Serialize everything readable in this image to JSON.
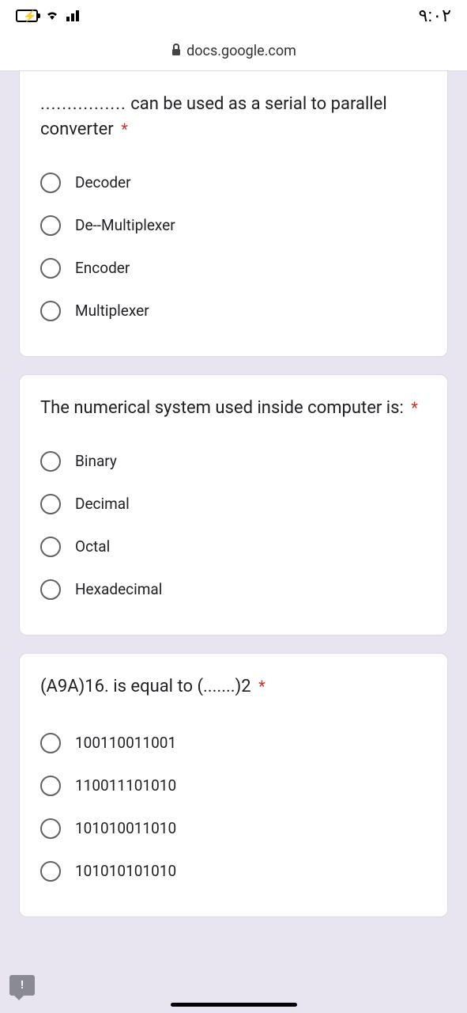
{
  "status_bar": {
    "time": "۹:۰۲"
  },
  "url_bar": {
    "domain": "docs.google.com"
  },
  "questions": [
    {
      "prefix": "................",
      "text": " can be used as a serial to parallel converter",
      "required": "*",
      "options": [
        "Decoder",
        "De--Multiplexer",
        "Encoder",
        "Multiplexer"
      ]
    },
    {
      "text": "The numerical system used inside computer is:",
      "required": "*",
      "options": [
        "Binary",
        "Decimal",
        "Octal",
        "Hexadecimal"
      ]
    },
    {
      "text": "(A9A)16. is equal to (.......)2 ",
      "required": "*",
      "options": [
        "100110011001",
        "110011101010",
        "101010011010",
        "101010101010"
      ]
    }
  ],
  "feedback_label": "!"
}
